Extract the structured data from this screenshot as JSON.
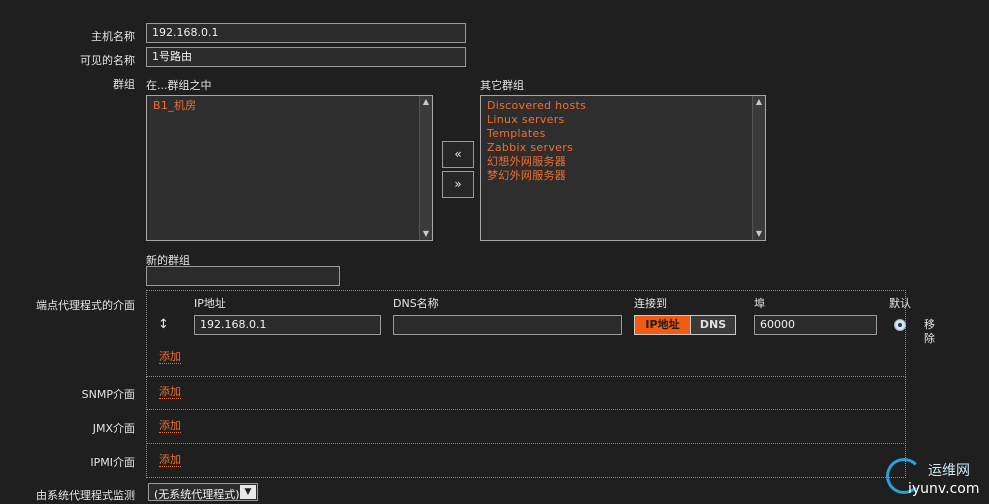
{
  "form": {
    "hostname": {
      "label": "主机名称",
      "value": "192.168.0.1"
    },
    "visible_name": {
      "label": "可见的名称",
      "value": "1号路由"
    },
    "groups": {
      "label": "群组",
      "in_groups_header": "在...群组之中",
      "in_groups": [
        "B1_机房"
      ],
      "other_groups_header": "其它群组",
      "other_groups": [
        "Discovered hosts",
        "Linux servers",
        "Templates",
        "Zabbix servers",
        "幻想外网服务器",
        "梦幻外网服务器"
      ],
      "move_left": "«",
      "move_right": "»"
    },
    "new_group": {
      "label": "新的群组",
      "value": ""
    },
    "agent_interfaces": {
      "label": "端点代理程式的介面",
      "col_ip": "IP地址",
      "col_dns": "DNS名称",
      "col_connect": "连接到",
      "col_port": "埠",
      "col_default": "默认",
      "drag_handle": "↕",
      "ip_value": "192.168.0.1",
      "dns_value": "",
      "connect_ip": "IP地址",
      "connect_dns": "DNS",
      "connect_selected": "IP地址",
      "port_value": "60000",
      "remove_1": "移",
      "remove_2": "除",
      "add": "添加"
    },
    "snmp": {
      "label": "SNMP介面",
      "add": "添加"
    },
    "jmx": {
      "label": "JMX介面",
      "add": "添加"
    },
    "ipmi": {
      "label": "IPMI介面",
      "add": "添加"
    },
    "proxy": {
      "label": "由系统代理程式监测",
      "value": "(无系统代理程式)"
    }
  },
  "watermark": {
    "cn": "运维网",
    "en": "iyunv.com"
  },
  "colors": {
    "background": "#1f1f1f",
    "accent": "#f26c2e",
    "selected_segment": "#f25c12"
  }
}
